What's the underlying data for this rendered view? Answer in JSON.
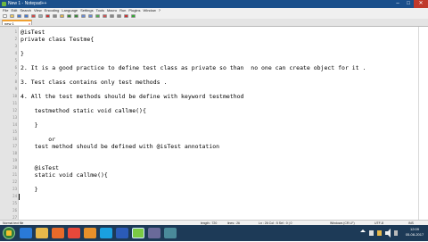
{
  "window": {
    "title": "New 1 - Notepad++",
    "min_glyph": "–",
    "max_glyph": "□",
    "close_glyph": "✕"
  },
  "menu": {
    "items": [
      "File",
      "Edit",
      "Search",
      "View",
      "Encoding",
      "Language",
      "Settings",
      "Tools",
      "Macro",
      "Run",
      "Plugins",
      "Window",
      "?"
    ]
  },
  "toolbar": {
    "icons": [
      "new-file-icon",
      "open-icon",
      "save-icon",
      "save-all-icon",
      "close-icon",
      "print-icon",
      "cut-icon",
      "copy-icon",
      "paste-icon",
      "undo-icon",
      "redo-icon",
      "find-icon",
      "replace-icon",
      "zoom-in-icon",
      "zoom-out-icon",
      "wrap-icon",
      "indent-icon",
      "macro-record-icon",
      "macro-play-icon"
    ]
  },
  "tab": {
    "label": "new 1",
    "close_glyph": "x"
  },
  "editor": {
    "lines": [
      "@isTest",
      "private class Testme{",
      "",
      "}",
      "",
      "2. It is a good practice to define test class as private so than  no one can create object for it .",
      "",
      "3. Test class contains only test methods .",
      "",
      "4. All the test methods should be define with keyword testmethod",
      "",
      "    testmethod static void callme(){",
      "",
      "    }",
      "",
      "        or",
      "    test method should be defined with @isTest annotation",
      "",
      "",
      "    @isTest",
      "    static void callme(){",
      "",
      "    }",
      "",
      ""
    ],
    "line_numbers": [
      "1",
      "2",
      "3",
      "4",
      "5",
      "6",
      "7",
      "8",
      "9",
      "10",
      "11",
      "12",
      "13",
      "14",
      "15",
      "16",
      "17",
      "18",
      "19",
      "20",
      "21",
      "22",
      "23",
      "24",
      "25",
      "26",
      "27"
    ]
  },
  "status": {
    "file_type": "Normal text file",
    "length": "length : 720",
    "lines": "lines : 26",
    "position": "Ln : 26    Col : 5    Sel : 0 | 0",
    "eol": "Windows (CR LF)",
    "encoding": "UTF-8",
    "mode": "INS"
  },
  "taskbar": {
    "apps": [
      "ie-icon",
      "folder-icon",
      "media-player-icon",
      "chrome-icon",
      "firefox-icon",
      "skype-icon",
      "word-icon",
      "notepadpp-icon",
      "app-icon",
      "app-icon-2"
    ],
    "time": "12:09",
    "date": "05-08-2017"
  }
}
